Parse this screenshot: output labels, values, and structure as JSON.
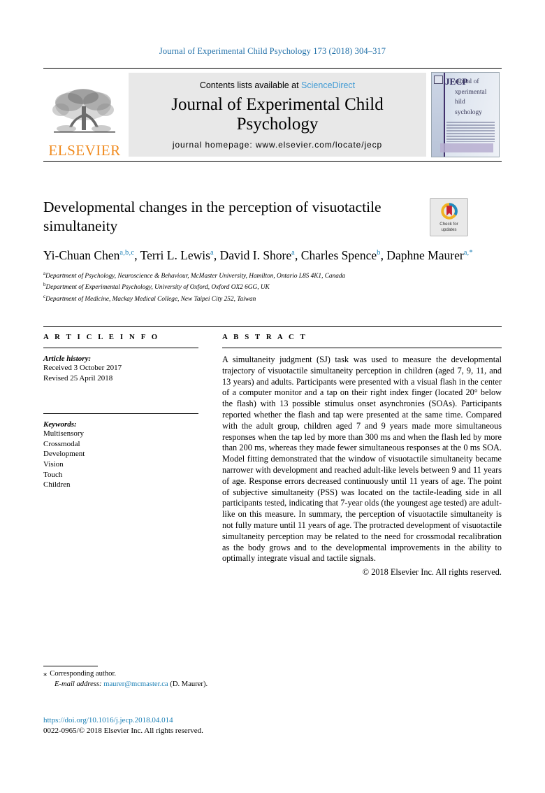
{
  "running_head": "Journal of Experimental Child Psychology 173 (2018) 304–317",
  "masthead": {
    "publisher_name": "ELSEVIER",
    "contents_prefix": "Contents lists available at ",
    "contents_link": "ScienceDirect",
    "journal_title": "Journal of Experimental Child Psychology",
    "homepage": "journal homepage: www.elsevier.com/locate/jecp",
    "cover": {
      "initials": "JECP",
      "words": [
        "ournal of",
        "xperimental",
        "hild",
        "sychology"
      ]
    }
  },
  "article": {
    "title": "Developmental changes in the perception of visuotactile simultaneity",
    "crossmark_label_line1": "Check for",
    "crossmark_label_line2": "updates",
    "authors": [
      {
        "name": "Yi-Chuan Chen",
        "marks": "a,b,c",
        "sep": ", "
      },
      {
        "name": "Terri L. Lewis",
        "marks": "a",
        "sep": ", "
      },
      {
        "name": "David I. Shore",
        "marks": "a",
        "sep": ", "
      },
      {
        "name": "Charles Spence",
        "marks": "b",
        "sep": ", "
      },
      {
        "name": "Daphne Maurer",
        "marks": "a,*",
        "sep": ""
      }
    ],
    "affiliations": [
      {
        "mark": "a",
        "text": "Department of Psychology, Neuroscience & Behaviour, McMaster University, Hamilton, Ontario L8S 4K1, Canada"
      },
      {
        "mark": "b",
        "text": "Department of Experimental Psychology, University of Oxford, Oxford OX2 6GG, UK"
      },
      {
        "mark": "c",
        "text": "Department of Medicine, Mackay Medical College, New Taipei City 252, Taiwan"
      }
    ]
  },
  "article_info": {
    "heading": "A R T I C L E    I N F O",
    "history_label": "Article history:",
    "history": [
      "Received 3 October 2017",
      "Revised 25 April 2018"
    ],
    "keywords_label": "Keywords:",
    "keywords": [
      "Multisensory",
      "Crossmodal",
      "Development",
      "Vision",
      "Touch",
      "Children"
    ]
  },
  "abstract": {
    "heading": "A B S T R A C T",
    "text": "A simultaneity judgment (SJ) task was used to measure the developmental trajectory of visuotactile simultaneity perception in children (aged 7, 9, 11, and 13 years) and adults. Participants were presented with a visual flash in the center of a computer monitor and a tap on their right index finger (located 20° below the flash) with 13 possible stimulus onset asynchronies (SOAs). Participants reported whether the flash and tap were presented at the same time. Compared with the adult group, children aged 7 and 9 years made more simultaneous responses when the tap led by more than 300 ms and when the flash led by more than 200 ms, whereas they made fewer simultaneous responses at the 0 ms SOA. Model fitting demonstrated that the window of visuotactile simultaneity became narrower with development and reached adult-like levels between 9 and 11 years of age. Response errors decreased continuously until 11 years of age. The point of subjective simultaneity (PSS) was located on the tactile-leading side in all participants tested, indicating that 7-year olds (the youngest age tested) are adult-like on this measure. In summary, the perception of visuotactile simultaneity is not fully mature until 11 years of age. The protracted development of visuotactile simultaneity perception may be related to the need for crossmodal recalibration as the body grows and to the developmental improvements in the ability to optimally integrate visual and tactile signals.",
    "copyright": "© 2018 Elsevier Inc. All rights reserved."
  },
  "footer": {
    "corresponding_marker": "⁎",
    "corresponding_text": "Corresponding author.",
    "email_label": "E-mail address:",
    "email": "maurer@mcmaster.ca",
    "email_suffix": "(D. Maurer).",
    "doi": "https://doi.org/10.1016/j.jecp.2018.04.014",
    "issn_line": "0022-0965/© 2018 Elsevier Inc. All rights reserved."
  },
  "colors": {
    "link_blue": "#1a7fb5",
    "sciencedirect_blue": "#3f9ad4",
    "elsevier_orange": "#f08a1d"
  }
}
